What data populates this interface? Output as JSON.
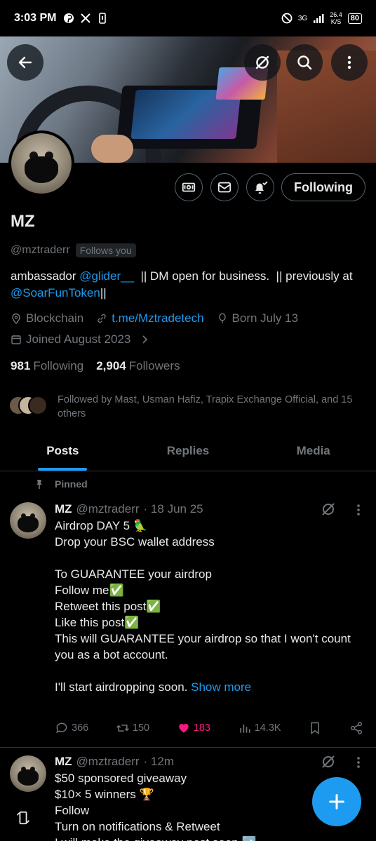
{
  "status_bar": {
    "time": "3:03 PM",
    "net_type": "3G",
    "speed_value": "26.4",
    "speed_unit": "K/S",
    "battery": "80"
  },
  "header": {
    "back_icon": "arrow-left-icon",
    "grok_icon": "slash-circle-icon",
    "search_icon": "search-icon",
    "more_icon": "more-vertical-icon"
  },
  "profile": {
    "name": "MZ",
    "handle": "@mztraderr",
    "follows_you": "Follows you",
    "follow_button": "Following",
    "bio_part1": "ambassador ",
    "bio_mention1": "@glider__",
    "bio_part2": "  || DM open for business.  || previously at ",
    "bio_mention2": "@SoarFunToken",
    "bio_part3": "||",
    "location": "Blockchain",
    "website": "t.me/Mztradetech",
    "birthday": "Born July 13",
    "joined": "Joined August 2023",
    "following_count": "981",
    "following_label": "Following",
    "followers_count": "2,904",
    "followers_label": "Followers",
    "followed_by": "Followed by Mast, Usman Hafiz, Trapix Exchange Official, and 15 others"
  },
  "tabs": [
    {
      "label": "Posts",
      "active": true
    },
    {
      "label": "Replies",
      "active": false
    },
    {
      "label": "Media",
      "active": false
    }
  ],
  "pinned_label": "Pinned",
  "posts": [
    {
      "name": "MZ",
      "handle": "@mztraderr",
      "date": "· 18 Jun 25",
      "title": "Airdrop DAY 5 🦜",
      "text": "Drop your BSC wallet address\n\nTo GUARANTEE your airdrop\nFollow me✅\nRetweet this post✅\nLike this post✅\nThis will GUARANTEE your airdrop so that I won't count you as a bot account.\n\nI'll start airdropping soon. ",
      "show_more": "Show more",
      "replies": "366",
      "retweets": "150",
      "likes": "183",
      "views": "14.3K"
    },
    {
      "name": "MZ",
      "handle": "@mztraderr",
      "date": "· 12m",
      "text": "$50 sponsored giveaway\n$10× 5 winners 🏆\nFollow\nTurn on notifications & Retweet\nI will make the giveaway post soon ➡️"
    }
  ],
  "colors": {
    "accent": "#1d9bf0",
    "like": "#f91880",
    "muted": "#71767b",
    "border": "#2f3336"
  }
}
